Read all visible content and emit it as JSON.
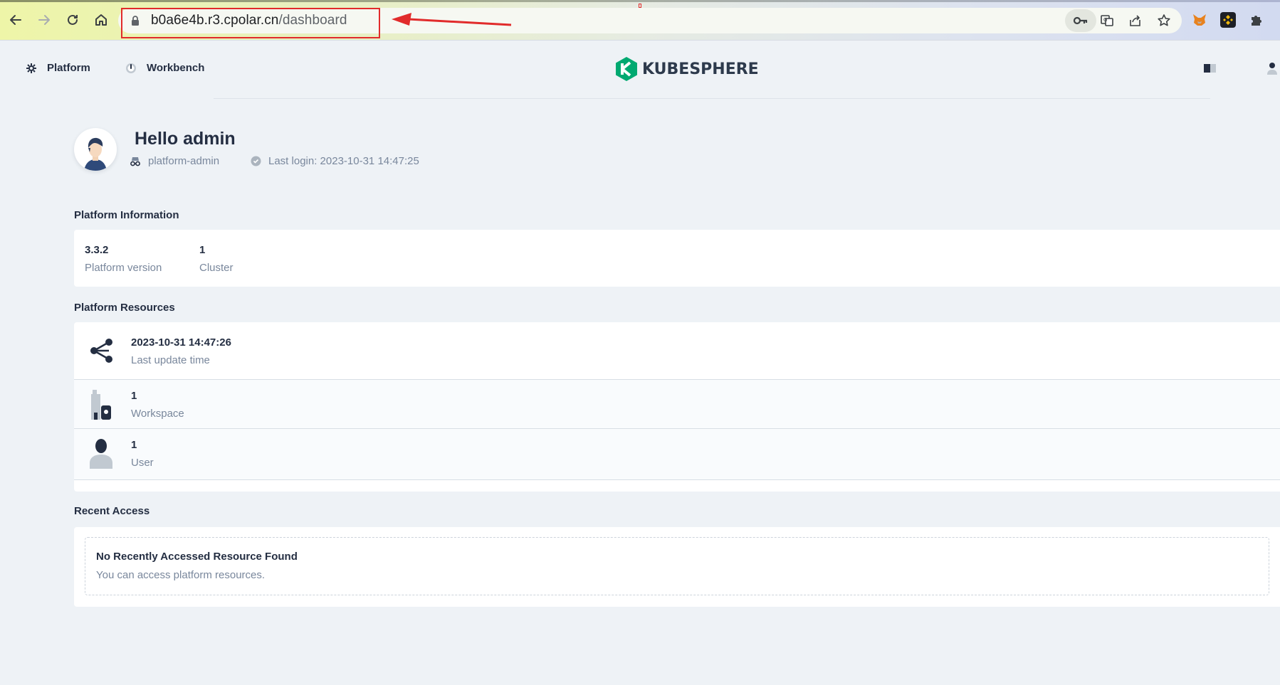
{
  "browser": {
    "url_host": "b0a6e4b.r3.cpolar.cn",
    "url_path": "/dashboard"
  },
  "header": {
    "nav": [
      {
        "label": "Platform",
        "icon": "gear-icon"
      },
      {
        "label": "Workbench",
        "icon": "dashboard-icon"
      }
    ],
    "logo_text": "KUBESPHERE",
    "brand_color": "#00a971"
  },
  "user": {
    "greeting": "Hello admin",
    "role": "platform-admin",
    "last_login": "Last login: 2023-10-31 14:47:25"
  },
  "platform_info": {
    "title": "Platform Information",
    "stats": [
      {
        "value": "3.3.2",
        "label": "Platform version"
      },
      {
        "value": "1",
        "label": "Cluster"
      }
    ]
  },
  "platform_resources": {
    "title": "Platform Resources",
    "rows": [
      {
        "value": "2023-10-31 14:47:26",
        "label": "Last update time",
        "icon": "share-nodes-icon"
      },
      {
        "value": "1",
        "label": "Workspace",
        "icon": "workspace-icon"
      },
      {
        "value": "1",
        "label": "User",
        "icon": "user-icon"
      }
    ]
  },
  "recent_access": {
    "title": "Recent Access",
    "empty_title": "No Recently Accessed Resource Found",
    "empty_sub": "You can access platform resources."
  },
  "annotation_color": "#e12b2b"
}
